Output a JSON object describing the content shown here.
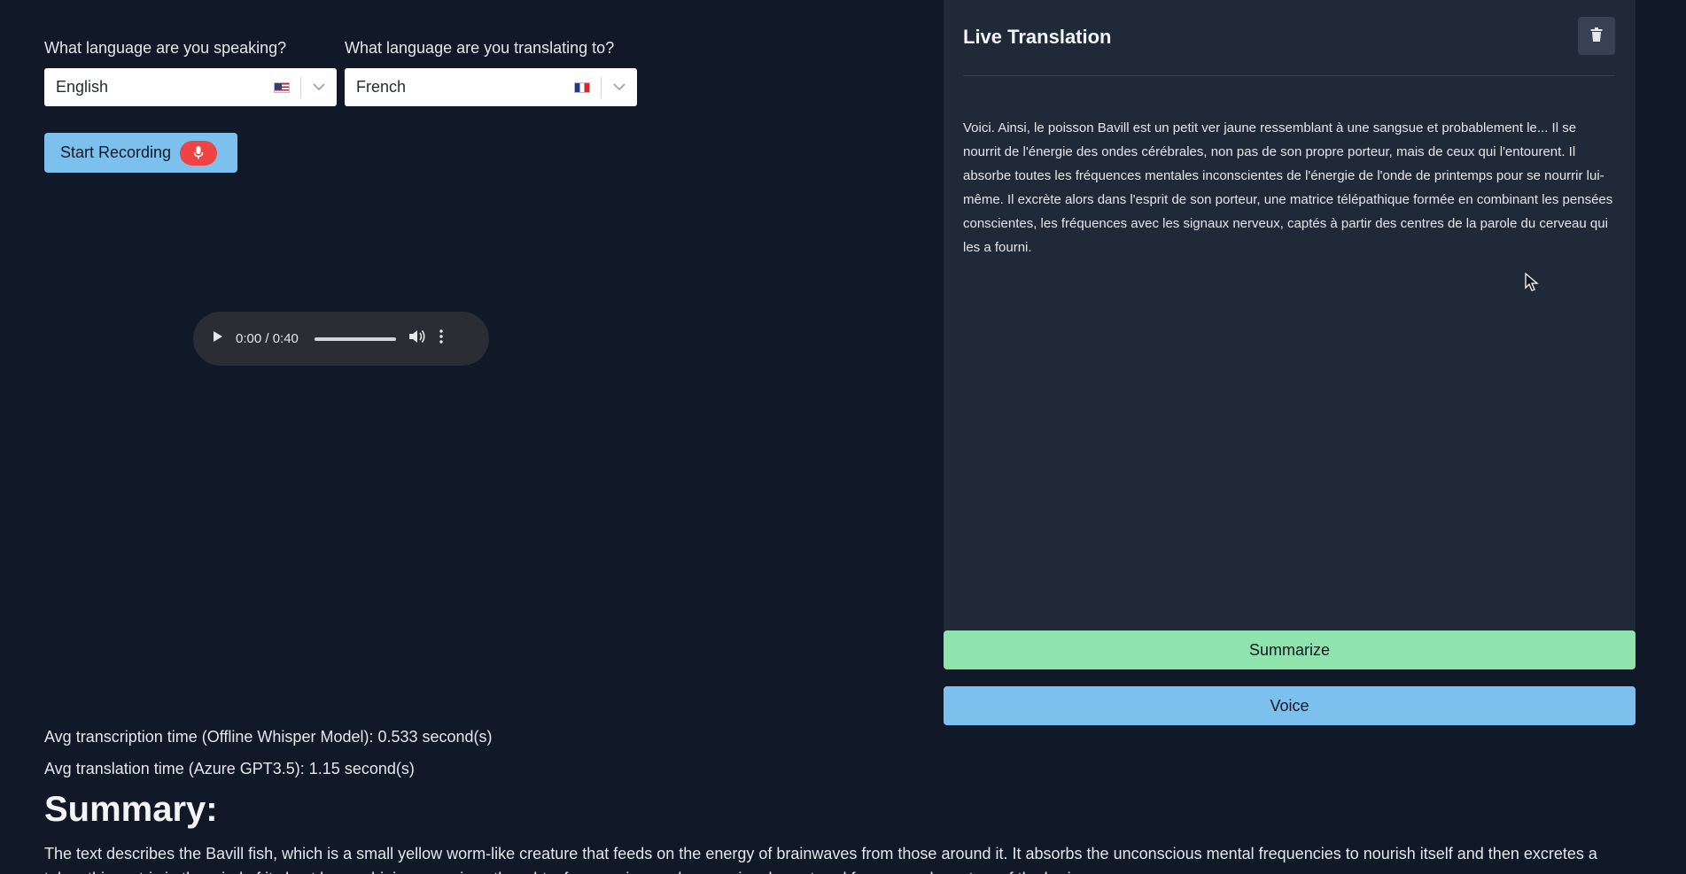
{
  "languages": {
    "speaking": {
      "label": "What language are you speaking?",
      "value": "English",
      "flag": "us-flag-icon"
    },
    "translating": {
      "label": "What language are you translating to?",
      "value": "French",
      "flag": "fr-flag-icon"
    }
  },
  "recording": {
    "button_label": "Start Recording",
    "icon": "microphone-icon",
    "icon_color": "#ef4444",
    "button_color": "#7cc1ee"
  },
  "audio_player": {
    "time": "0:00 / 0:40"
  },
  "stats": {
    "transcription": "Avg transcription time (Offline Whisper Model): 0.533 second(s)",
    "translation": "Avg translation time (Azure GPT3.5): 1.15 second(s)"
  },
  "summary": {
    "title": "Summary:",
    "text": "The text describes the Bavill fish, which is a small yellow worm-like creature that feeds on the energy of brainwaves from those around it. It absorbs the unconscious mental frequencies to nourish itself and then excretes a telepathic matrix in the mind of its host by combining conscious thoughts, frequencies, and nerve signals captured from speech centers of the brain."
  },
  "live_translation": {
    "title": "Live Translation",
    "text": "Voici. Ainsi, le poisson Bavill est un petit ver jaune ressemblant à une sangsue et probablement le... Il se nourrit de l'énergie des ondes cérébrales, non pas de son propre porteur, mais de ceux qui l'entourent. Il absorbe toutes les fréquences mentales inconscientes de l'énergie de l'onde de printemps pour se nourrir lui-même. Il excrète alors dans l'esprit de son porteur, une matrice télépathique formée en combinant les pensées conscientes, les fréquences avec les signaux nerveux, captés à partir des centres de la parole du cerveau qui les a fourni."
  },
  "actions": {
    "summarize_label": "Summarize",
    "summarize_color": "#8fe3ad",
    "voice_label": "Voice",
    "voice_color": "#7cc1ee"
  },
  "theme": {
    "background": "#111827",
    "panel": "#1f2937"
  }
}
